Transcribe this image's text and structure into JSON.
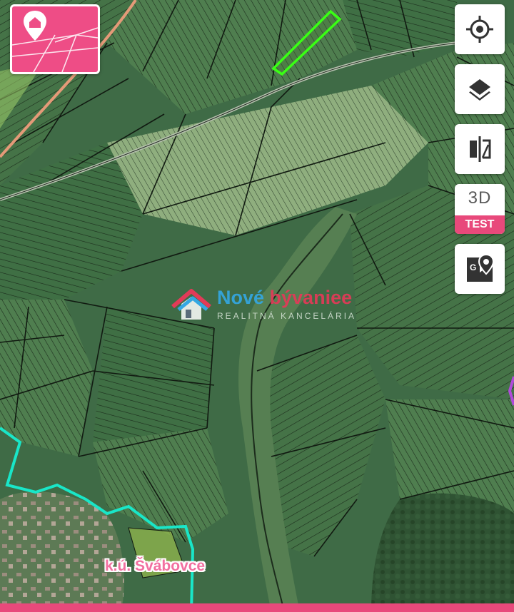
{
  "map": {
    "type": "cadastral-satellite",
    "cadastral_area_label": "k.ú. Švábovce"
  },
  "watermark": {
    "brand_part1": "Nové ",
    "brand_part2": "bývanie",
    "brand_accent": "e",
    "tagline": "REALITNÁ KANCELÁRIA"
  },
  "controls": {
    "locate": {
      "icon": "crosshair-locate-icon"
    },
    "layers": {
      "icon": "layers-icon"
    },
    "compare": {
      "icon": "split-compare-icon"
    },
    "mode_3d": {
      "label": "3D",
      "badge": "TEST"
    },
    "google_maps": {
      "icon": "google-maps-pin-icon"
    }
  },
  "parcel_card": {
    "icon": "parcel-location-icon"
  },
  "colors": {
    "accent": "#e8497b",
    "parcel_highlight": "#39ff14",
    "cadastral_boundary": "#19e6c8",
    "terrain": "#3f6b46"
  }
}
